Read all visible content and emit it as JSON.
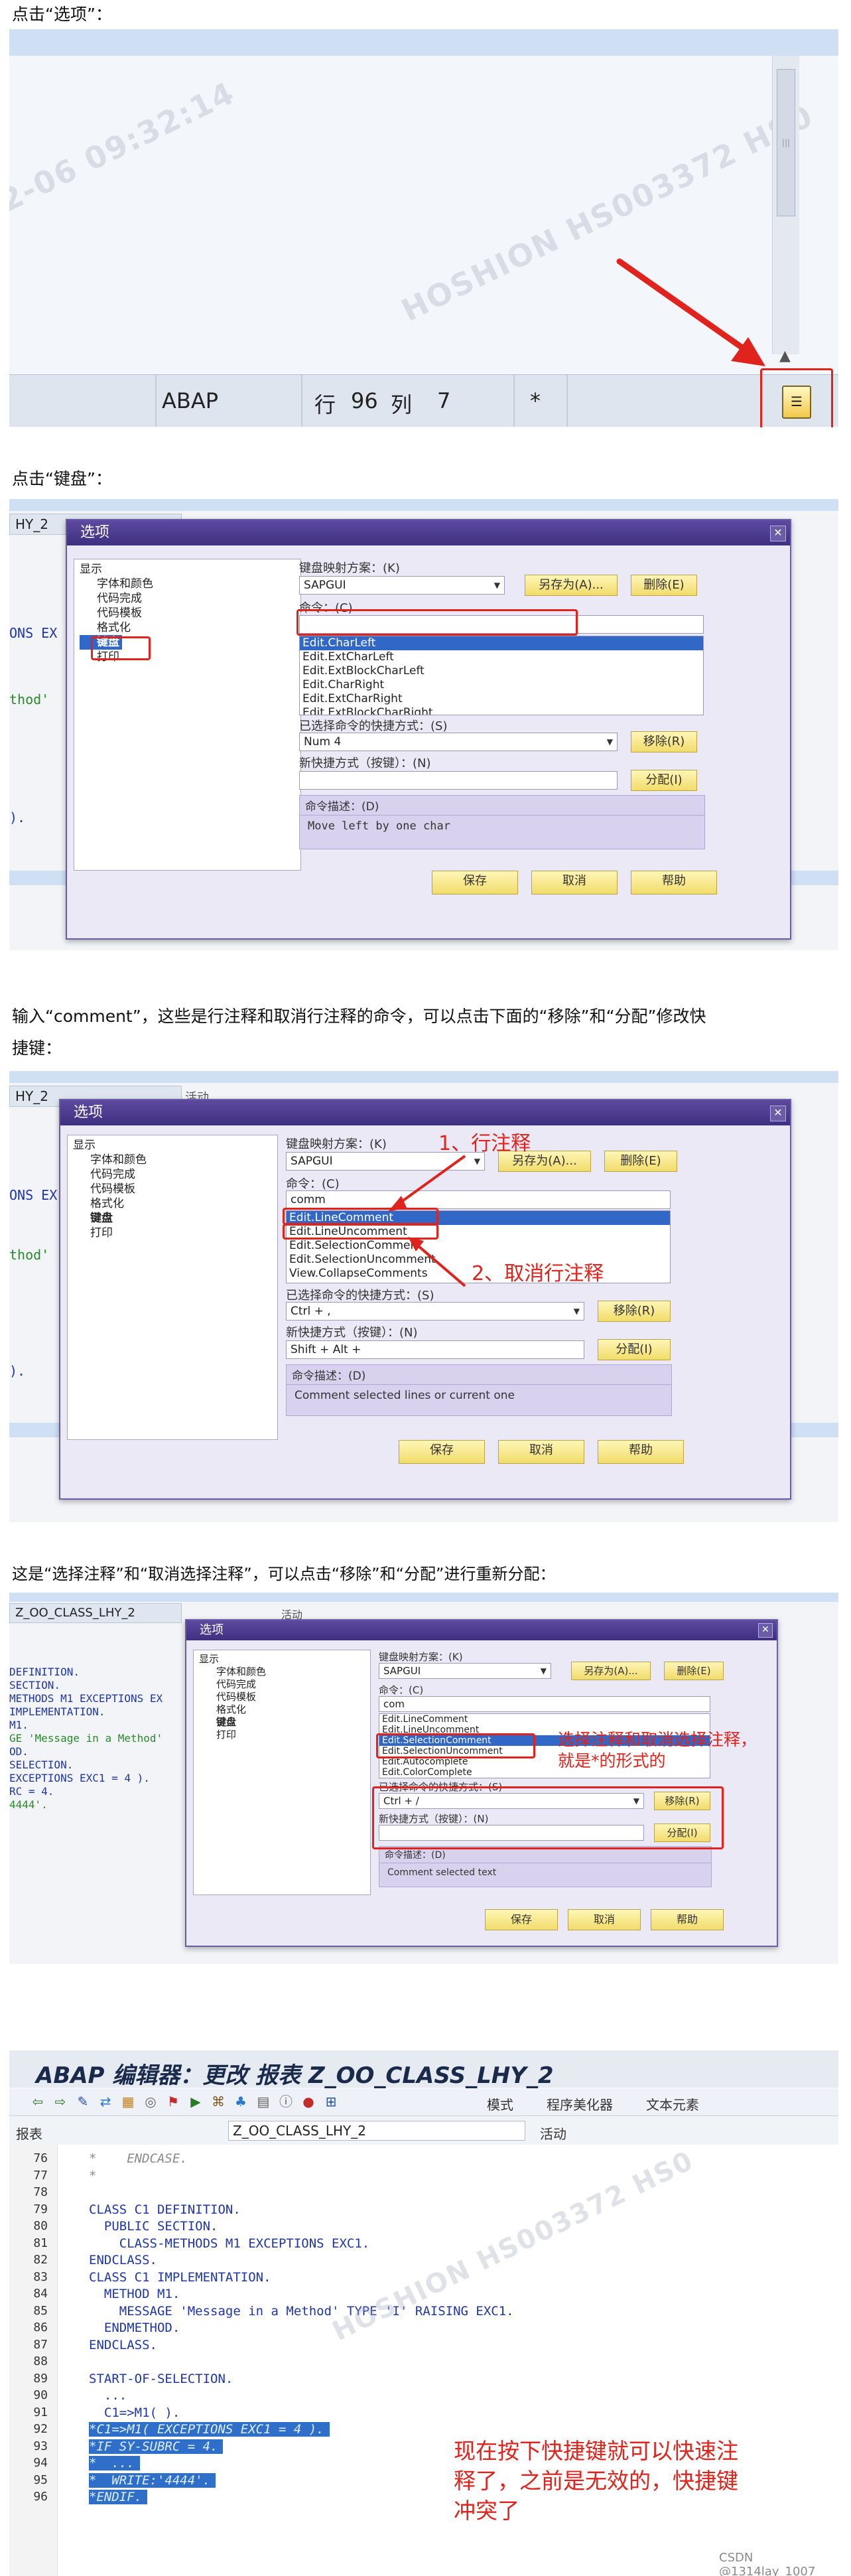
{
  "captions": {
    "c1": "点击“选项”：",
    "c2": "点击“键盘”：",
    "c3a": "输入“comment”，这些是行注释和取消行注释的命令，可以点击下面的“移除”和“分配”修改快",
    "c3b": "捷键：",
    "c4": "这是“选择注释”和“取消选择注释”，可以点击“移除”和“分配”进行重新分配："
  },
  "watermark": "HOSHION HS003372 HS0",
  "statusbar": {
    "lang": "ABAP",
    "row_label": "行",
    "row": "96",
    "col_label": "列",
    "col": "7",
    "flag": "*",
    "scroll_mark": "|||",
    "datetime": "2-06 09:32:14"
  },
  "bg": {
    "prog_short": "HY_2",
    "active": "活动",
    "ons_exc": "ONS EX",
    "thod": "thod'",
    "paren": ").",
    "prog_full": "Z_OO_CLASS_LHY_2",
    "left_code": [
      "DEFINITION.",
      "SECTION.",
      "METHODS M1 EXCEPTIONS EX",
      "",
      "IMPLEMENTATION.",
      "M1.",
      "GE 'Message in a Method'",
      "OD.",
      "",
      "",
      "SELECTION.",
      "",
      "",
      "EXCEPTIONS EXC1 = 4 ).",
      "RC = 4.",
      "",
      "4444'."
    ]
  },
  "dialog": {
    "title": "选项",
    "tree": [
      "显示",
      "字体和颜色",
      "代码完成",
      "代码模板",
      "格式化",
      "键盘",
      "打印"
    ],
    "scheme_label": "键盘映射方案：(K)",
    "scheme_value": "SAPGUI",
    "save_as": "另存为(A)...",
    "delete": "删除(E)",
    "command_label": "命令：(C)",
    "shortcut_label": "已选择命令的快捷方式：(S)",
    "remove": "移除(R)",
    "new_shortcut_label": "新快捷方式（按键）：(N)",
    "assign": "分配(I)",
    "desc_label": "命令描述：(D)",
    "ok": "保存",
    "cancel": "取消",
    "help": "帮助"
  },
  "d1": {
    "command": "",
    "list": [
      "Edit.CharLeft",
      "Edit.ExtCharLeft",
      "Edit.ExtBlockCharLeft",
      "Edit.CharRight",
      "Edit.ExtCharRight",
      "Edit.ExtBlockCharRight"
    ],
    "shortcut": "Num 4",
    "new_shortcut": "",
    "desc": "Move left by one char"
  },
  "d2": {
    "command": "comm",
    "list": [
      "Edit.LineComment",
      "Edit.LineUncomment",
      "Edit.SelectionComment",
      "Edit.SelectionUncomment",
      "View.CollapseComments"
    ],
    "shortcut": "Ctrl + ,",
    "new_shortcut": "Shift + Alt + ",
    "desc": "Comment selected lines or current one",
    "ann1": "1、行注释",
    "ann2": "2、取消行注释"
  },
  "d3": {
    "command": "com",
    "list": [
      "Edit.LineComment",
      "Edit.LineUncomment",
      "Edit.SelectionComment",
      "Edit.SelectionUncomment",
      "Edit.Autocomplete",
      "Edit.ColorComplete"
    ],
    "shortcut": "Ctrl + /",
    "new_shortcut": "",
    "desc": "Comment selected text",
    "ann": "选择注释和取消选择注释，",
    "ann2": "就是*的形式的"
  },
  "editor": {
    "title": "ABAP 编辑器：更改 报表 Z_OO_CLASS_LHY_2",
    "toolbar_text": [
      "模式",
      "程序美化器",
      "文本元素"
    ],
    "report_label": "报表",
    "report_name": "Z_OO_CLASS_LHY_2",
    "status": "活动",
    "lines": [
      {
        "n": "76",
        "t": "*    ENDCASE."
      },
      {
        "n": "77",
        "t": "*"
      },
      {
        "n": "78",
        "t": ""
      },
      {
        "n": "79",
        "t": "CLASS C1 DEFINITION."
      },
      {
        "n": "80",
        "t": "  PUBLIC SECTION."
      },
      {
        "n": "81",
        "t": "    CLASS-METHODS M1 EXCEPTIONS EXC1."
      },
      {
        "n": "82",
        "t": "ENDCLASS."
      },
      {
        "n": "83",
        "t": "CLASS C1 IMPLEMENTATION."
      },
      {
        "n": "84",
        "t": "  METHOD M1."
      },
      {
        "n": "85",
        "t": "    MESSAGE 'Message in a Method' TYPE 'I' RAISING EXC1."
      },
      {
        "n": "86",
        "t": "  ENDMETHOD."
      },
      {
        "n": "87",
        "t": "ENDCLASS."
      },
      {
        "n": "88",
        "t": ""
      },
      {
        "n": "89",
        "t": "START-OF-SELECTION."
      },
      {
        "n": "90",
        "t": "  ..."
      },
      {
        "n": "91",
        "t": "  C1=>M1( )."
      },
      {
        "n": "92",
        "t": "*C1=>M1( EXCEPTIONS EXC1 = 4 )."
      },
      {
        "n": "93",
        "t": "*IF SY-SUBRC = 4."
      },
      {
        "n": "94",
        "t": "*  ..."
      },
      {
        "n": "95",
        "t": "*  WRITE:'4444'."
      },
      {
        "n": "96",
        "t": "*ENDIF."
      }
    ],
    "note1": "现在按下快捷键就可以快速注",
    "note2": "释了，之前是无效的，快捷键",
    "note3": "冲突了",
    "csdn": "CSDN @1314lay_1007"
  }
}
